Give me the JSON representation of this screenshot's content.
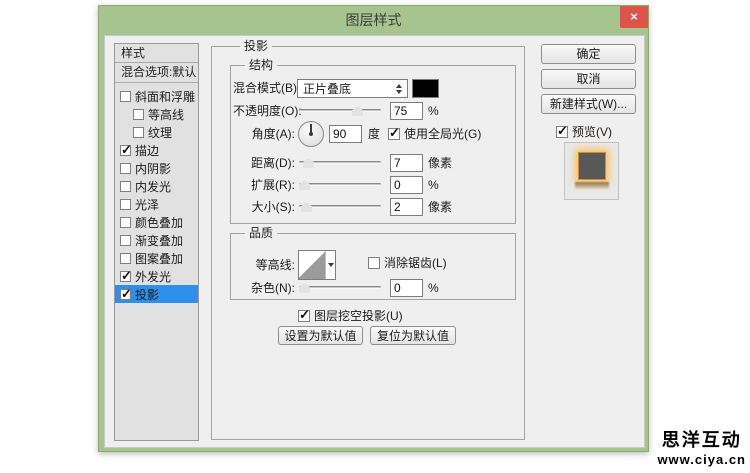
{
  "page": {
    "watermark_line1": "思洋互动",
    "watermark_line2": "www.ciya.cn"
  },
  "colors": {
    "titlebar_green": "#a6c48d",
    "close_red": "#de5448",
    "selection_blue": "#2e8fed",
    "blend_swatch": "#000000"
  },
  "dialog": {
    "title": "图层样式",
    "close_glyph": "×",
    "sidebar": {
      "header": "样式",
      "blending_options": "混合选项:默认",
      "items": [
        {
          "label": "斜面和浮雕",
          "checked": false,
          "indent": false,
          "selected": false
        },
        {
          "label": "等高线",
          "checked": false,
          "indent": true,
          "selected": false
        },
        {
          "label": "纹理",
          "checked": false,
          "indent": true,
          "selected": false
        },
        {
          "label": "描边",
          "checked": true,
          "indent": false,
          "selected": false
        },
        {
          "label": "内阴影",
          "checked": false,
          "indent": false,
          "selected": false
        },
        {
          "label": "内发光",
          "checked": false,
          "indent": false,
          "selected": false
        },
        {
          "label": "光泽",
          "checked": false,
          "indent": false,
          "selected": false
        },
        {
          "label": "颜色叠加",
          "checked": false,
          "indent": false,
          "selected": false
        },
        {
          "label": "渐变叠加",
          "checked": false,
          "indent": false,
          "selected": false
        },
        {
          "label": "图案叠加",
          "checked": false,
          "indent": false,
          "selected": false
        },
        {
          "label": "外发光",
          "checked": true,
          "indent": false,
          "selected": false
        },
        {
          "label": "投影",
          "checked": true,
          "indent": false,
          "selected": true
        }
      ]
    },
    "panel": {
      "title": "投影",
      "structure": {
        "title": "结构",
        "blend_mode_label": "混合模式(B):",
        "blend_mode_value": "正片叠底",
        "opacity_label": "不透明度(O):",
        "opacity_value": "75",
        "opacity_unit": "%",
        "opacity_pct": 75,
        "angle_label": "角度(A):",
        "angle_value": "90",
        "angle_unit": "度",
        "global_light": {
          "label": "使用全局光(G)",
          "checked": true
        },
        "distance_label": "距离(D):",
        "distance_value": "7",
        "distance_unit": "像素",
        "distance_pct": 6,
        "spread_label": "扩展(R):",
        "spread_value": "0",
        "spread_unit": "%",
        "spread_pct": 0,
        "size_label": "大小(S):",
        "size_value": "2",
        "size_unit": "像素",
        "size_pct": 3
      },
      "quality": {
        "title": "品质",
        "contour_label": "等高线:",
        "anti_alias": {
          "label": "消除锯齿(L)",
          "checked": false
        },
        "noise_label": "杂色(N):",
        "noise_value": "0",
        "noise_unit": "%",
        "noise_pct": 0
      },
      "knockout": {
        "label": "图层挖空投影(U)",
        "checked": true
      },
      "set_default_label": "设置为默认值",
      "reset_default_label": "复位为默认值"
    },
    "actions": {
      "ok": "确定",
      "cancel": "取消",
      "new_style": "新建样式(W)...",
      "preview": {
        "label": "预览(V)",
        "checked": true
      }
    }
  }
}
